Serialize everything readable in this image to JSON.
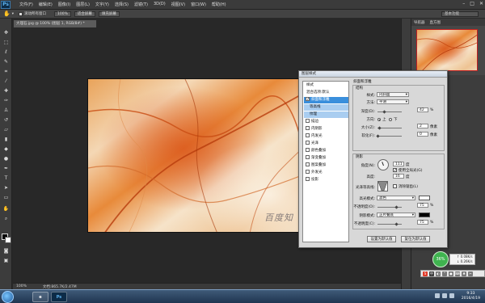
{
  "app": {
    "logo": "Ps",
    "menus": [
      "文件(F)",
      "编辑(E)",
      "图像(I)",
      "图层(L)",
      "文字(Y)",
      "选择(S)",
      "滤镜(T)",
      "3D(D)",
      "视图(V)",
      "窗口(W)",
      "帮助(H)"
    ],
    "window_controls": [
      "minimize-icon",
      "maximize-icon",
      "close-icon"
    ]
  },
  "options_bar": {
    "scroll_all_label": "滚动所有窗口",
    "zoom_value": "100%",
    "fit_screen": "适合屏幕",
    "fill_screen": "填充屏幕",
    "workspace": "基本功能"
  },
  "document": {
    "tab_title": "大理石.jpg @ 100% (图层 1, RGB/8#) *",
    "watermark": "百度知",
    "status_zoom": "100%",
    "status_doc": "文档:865.7K/2.47M"
  },
  "navigator": {
    "tabs": [
      "导航器",
      "直方图"
    ]
  },
  "layer_style": {
    "title": "图层样式",
    "styles_header": "样式",
    "blend_options": "混合选项:默认",
    "items": [
      {
        "label": "斜面和浮雕",
        "checked": true,
        "selected": true
      },
      {
        "label": "等高线",
        "checked": false,
        "sub": true
      },
      {
        "label": "纹理",
        "checked": false,
        "sub": true
      },
      {
        "label": "描边",
        "checked": false
      },
      {
        "label": "内阴影",
        "checked": false
      },
      {
        "label": "内发光",
        "checked": false
      },
      {
        "label": "光泽",
        "checked": false
      },
      {
        "label": "颜色叠加",
        "checked": false
      },
      {
        "label": "渐变叠加",
        "checked": false
      },
      {
        "label": "图案叠加",
        "checked": false
      },
      {
        "label": "外发光",
        "checked": false
      },
      {
        "label": "投影",
        "checked": false
      }
    ],
    "section_title": "斜面和浮雕",
    "structure": {
      "title": "结构",
      "style_label": "样式:",
      "style_value": "内斜面",
      "technique_label": "方法:",
      "technique_value": "平滑",
      "depth_label": "深度(D):",
      "depth_value": "42",
      "direction_label": "方向:",
      "direction_up": "上",
      "direction_down": "下",
      "size_label": "大小(Z):",
      "size_value": "2",
      "soften_label": "软化(F):",
      "soften_value": "0",
      "unit_percent": "%",
      "unit_px": "像素"
    },
    "shading": {
      "title": "阴影",
      "angle_label": "角度(N):",
      "angle_value": "111",
      "angle_unit": "度",
      "global_light_label": "使用全局光(G)",
      "altitude_label": "高度:",
      "altitude_value": "16",
      "altitude_unit": "度",
      "gloss_contour_label": "光泽等高线:",
      "anti_alias_label": "消除锯齿(L)",
      "highlight_mode_label": "高光模式:",
      "highlight_mode_value": "滤色",
      "highlight_color": "#ffffff",
      "highlight_opacity_label": "不透明度(O):",
      "highlight_opacity_value": "75",
      "shadow_mode_label": "阴影模式:",
      "shadow_mode_value": "正片叠底",
      "shadow_color": "#000000",
      "shadow_opacity_label": "不透明度(C):",
      "shadow_opacity_value": "75"
    },
    "buttons": {
      "make_default": "设置为默认值",
      "reset_default": "复位为默认值"
    }
  },
  "system": {
    "float_percent": "36%",
    "net_up": "0.08K/s",
    "net_down": "0.26K/s",
    "clock_time": "9:33",
    "clock_date": "2016/4/19"
  }
}
